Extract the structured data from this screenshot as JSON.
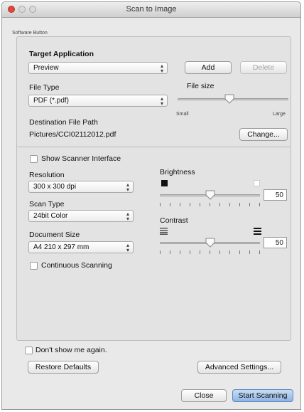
{
  "window": {
    "title": "Scan to Image"
  },
  "group_label": "Software Button",
  "target_app": {
    "label": "Target Application",
    "value": "Preview",
    "add": "Add",
    "delete": "Delete"
  },
  "file_type": {
    "label": "File Type",
    "value": "PDF (*.pdf)"
  },
  "file_size": {
    "label": "File size",
    "min_label": "Small",
    "max_label": "Large",
    "level": 0.47
  },
  "destination": {
    "label": "Destination File Path",
    "path": "Pictures/CCI02112012.pdf",
    "change": "Change..."
  },
  "scanner_interface": {
    "label": "Show Scanner Interface",
    "checked": false
  },
  "resolution": {
    "label": "Resolution",
    "value": "300 x 300 dpi"
  },
  "scan_type": {
    "label": "Scan Type",
    "value": "24bit Color"
  },
  "document_size": {
    "label": "Document Size",
    "value": "A4 210 x 297 mm"
  },
  "continuous": {
    "label": "Continuous Scanning",
    "checked": false
  },
  "brightness": {
    "label": "Brightness",
    "value": "50",
    "level": 0.5
  },
  "contrast": {
    "label": "Contrast",
    "value": "50",
    "level": 0.5
  },
  "dont_show": {
    "label": "Don't show me again.",
    "checked": false
  },
  "buttons": {
    "restore": "Restore Defaults",
    "advanced": "Advanced Settings...",
    "close": "Close",
    "start": "Start Scanning"
  },
  "colors": {
    "accent": "#8fb4e3",
    "close_light": "#e0473d"
  }
}
